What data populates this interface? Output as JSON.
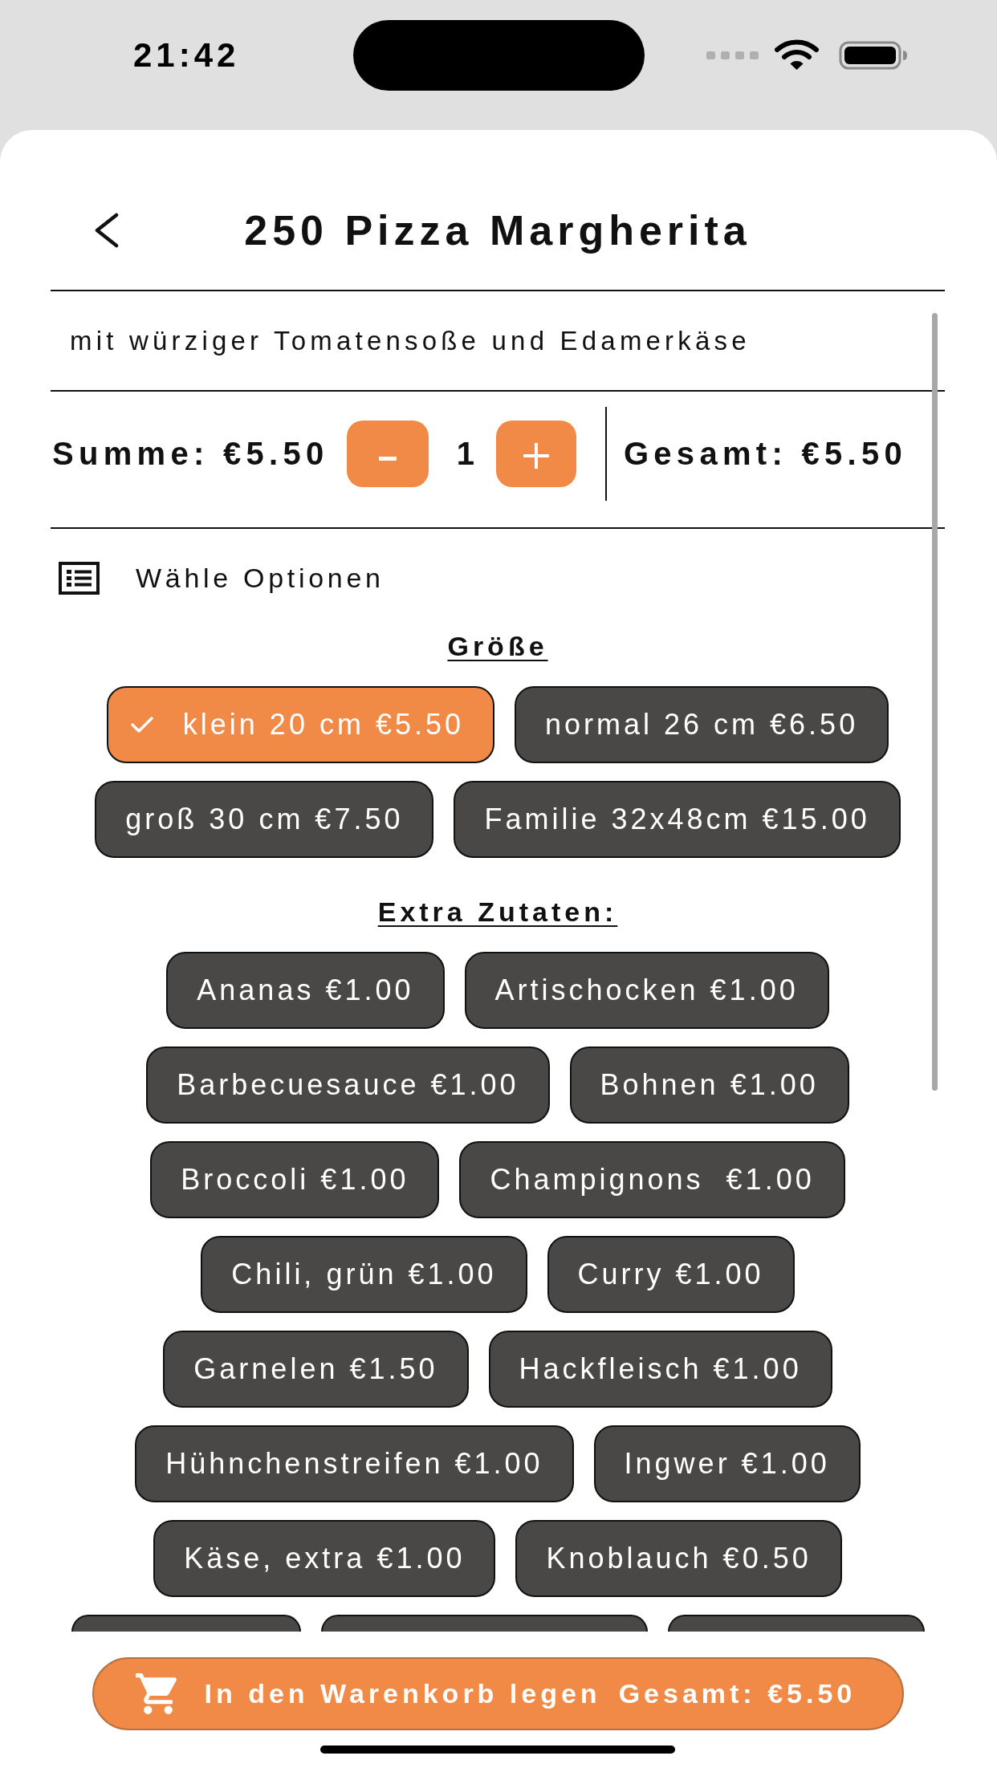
{
  "status_bar": {
    "time": "21:42"
  },
  "header": {
    "title": "250 Pizza Margherita"
  },
  "description": "mit würziger Tomatensoße und Edamerkäse",
  "summary": {
    "subtotal": "Summe: €5.50",
    "quantity": "1",
    "total": "Gesamt: €5.50"
  },
  "options_heading": "Wähle Optionen",
  "option_groups": [
    {
      "title": "Größe",
      "options": [
        {
          "label": "klein 20 cm €5.50",
          "selected": true
        },
        {
          "label": "normal 26 cm €6.50",
          "selected": false
        },
        {
          "label": "groß 30 cm €7.50",
          "selected": false
        },
        {
          "label": "Familie 32x48cm €15.00",
          "selected": false
        }
      ]
    },
    {
      "title": "Extra Zutaten:",
      "options": [
        {
          "label": "Ananas €1.00",
          "selected": false
        },
        {
          "label": "Artischocken €1.00",
          "selected": false
        },
        {
          "label": "Barbecuesauce €1.00",
          "selected": false
        },
        {
          "label": "Bohnen €1.00",
          "selected": false
        },
        {
          "label": "Broccoli €1.00",
          "selected": false
        },
        {
          "label": "Champignons  €1.00",
          "selected": false
        },
        {
          "label": "Chili, grün €1.00",
          "selected": false
        },
        {
          "label": "Curry €1.00",
          "selected": false
        },
        {
          "label": "Garnelen €1.50",
          "selected": false
        },
        {
          "label": "Hackfleisch €1.00",
          "selected": false
        },
        {
          "label": "Hühnchenstreifen €1.00",
          "selected": false
        },
        {
          "label": "Ingwer €1.00",
          "selected": false
        },
        {
          "label": "Käse, extra €1.00",
          "selected": false
        },
        {
          "label": "Knoblauch €0.50",
          "selected": false
        }
      ],
      "cut_off_options": [
        {
          "kind": "chip"
        },
        {
          "kind": "chip"
        },
        {
          "kind": "chip"
        }
      ]
    }
  ],
  "cart_button": {
    "label": "In den Warenkorb legen",
    "total": "Gesamt: €5.50"
  }
}
